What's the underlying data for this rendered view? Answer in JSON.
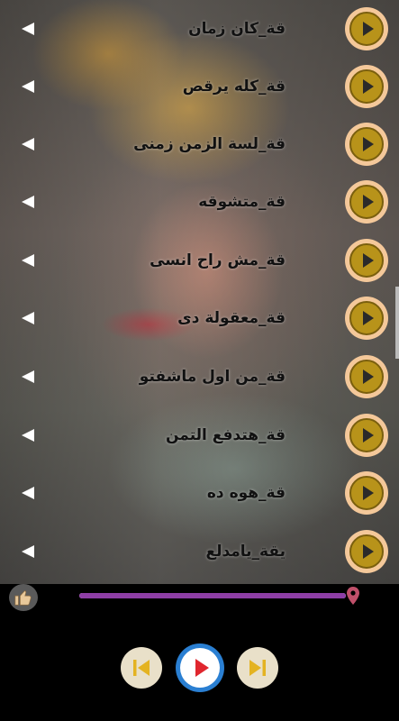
{
  "tracks": [
    {
      "title": "قة_كان زمان"
    },
    {
      "title": "قة_كله يرقص"
    },
    {
      "title": "قة_لسة الزمن زمنى"
    },
    {
      "title": "قة_متشوقه"
    },
    {
      "title": "قة_مش راح انسى"
    },
    {
      "title": "قة_معقولة دى"
    },
    {
      "title": "قة_من اول ماشفتو"
    },
    {
      "title": "قة_هتدفع التمن"
    },
    {
      "title": "قة_هوه ده"
    },
    {
      "title": "يقة_يامدلع"
    }
  ],
  "player": {
    "progress": 1.0,
    "colors": {
      "seek_fill": "#8e3ea6",
      "play_outer": "#2a7fd2",
      "play_triangle": "#e0262e",
      "item_button": "#b8931a"
    },
    "icons": {
      "like": "thumbs-up-icon",
      "seek_marker": "location-pin-icon",
      "prev": "skip-previous-icon",
      "play": "play-icon",
      "next": "skip-next-icon"
    }
  }
}
